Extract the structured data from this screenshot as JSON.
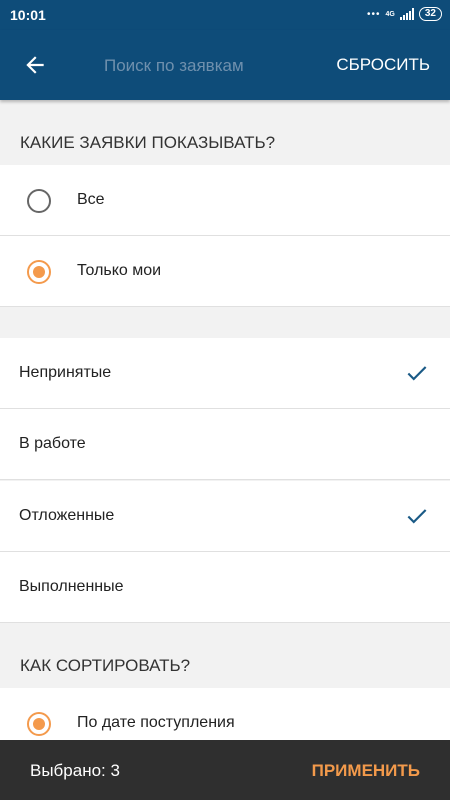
{
  "status_bar": {
    "time": "10:01",
    "signal_dots": "•••",
    "network": "4G",
    "battery": "32"
  },
  "app_bar": {
    "search_placeholder": "Поиск по заявкам",
    "reset_label": "СБРОСИТЬ"
  },
  "show_section": {
    "header": "КАКИЕ ЗАЯВКИ ПОКАЗЫВАТЬ?",
    "options": [
      {
        "label": "Все",
        "selected": false
      },
      {
        "label": "Только мои",
        "selected": true
      }
    ]
  },
  "status_filters": [
    {
      "label": "Непринятые",
      "checked": true
    },
    {
      "label": "В работе",
      "checked": false
    },
    {
      "label": "Отложенные",
      "checked": true
    },
    {
      "label": "Выполненные",
      "checked": false
    }
  ],
  "sort_section": {
    "header": "КАК СОРТИРОВАТЬ?",
    "options": [
      {
        "label": "По дате поступления",
        "selected": true
      }
    ]
  },
  "bottom_bar": {
    "selected_count_text": "Выбрано: 3",
    "apply_label": "ПРИМЕНИТЬ"
  },
  "colors": {
    "primary": "#0e4c79",
    "accent": "#f49a4c",
    "check": "#1a5a86",
    "bottom_bar": "#2f2f2f"
  },
  "icons": {
    "back": "arrow-left-icon",
    "check": "check-icon",
    "radio": "radio-icon"
  }
}
